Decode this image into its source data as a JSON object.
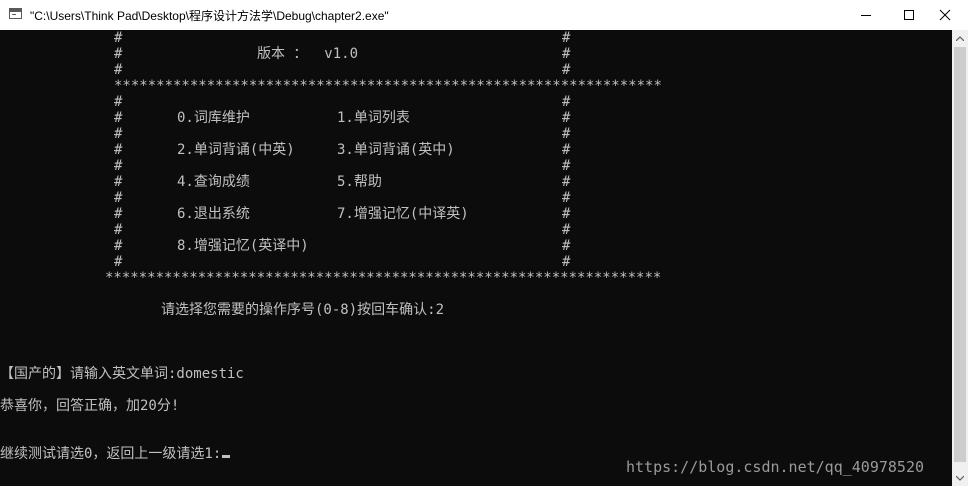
{
  "window": {
    "title": "\"C:\\Users\\Think Pad\\Desktop\\程序设计方法学\\Debug\\chapter2.exe\"",
    "app_icon": "console-window-icon",
    "controls": {
      "minimize_icon": "minimize-icon",
      "maximize_icon": "maximize-icon",
      "close_icon": "close-icon"
    }
  },
  "console": {
    "frame_top_lines": [
      "#",
      "#",
      "#"
    ],
    "version_label": "版本 ：  v1.0",
    "border_row": "*****************************************************************",
    "border_row_bottom": "******************************************************************",
    "hash": "#",
    "menu": {
      "item0": "0.词库维护",
      "item1": "1.单词列表",
      "item2": "2.单词背诵(中英)",
      "item3": "3.单词背诵(英中)",
      "item4": "4.查询成绩",
      "item5": "5.帮助",
      "item6": "6.退出系统",
      "item7": "7.增强记忆(中译英)",
      "item8": "8.增强记忆(英译中)"
    },
    "prompt_select": "请选择您需要的操作序号(0-8)按回车确认:2",
    "prompt_word": "【国产的】请输入英文单词:domestic",
    "result": "恭喜你，回答正确，加20分!",
    "prompt_continue": "继续测试请选0，返回上一级请选1:"
  },
  "colors": {
    "console_bg": "#0c0c0c",
    "console_text": "#c0c0c0",
    "titlebar_bg": "#ffffff"
  },
  "watermark": "https://blog.csdn.net/qq_40978520"
}
